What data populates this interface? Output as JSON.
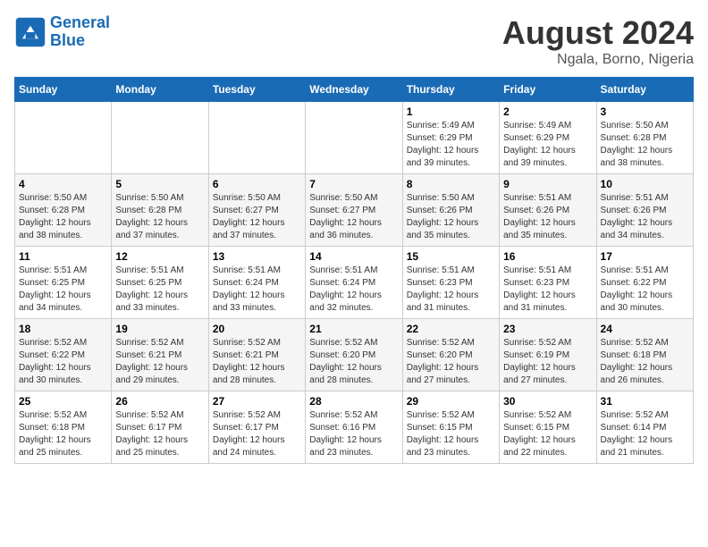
{
  "header": {
    "logo_general": "General",
    "logo_blue": "Blue",
    "month": "August 2024",
    "location": "Ngala, Borno, Nigeria"
  },
  "days_of_week": [
    "Sunday",
    "Monday",
    "Tuesday",
    "Wednesday",
    "Thursday",
    "Friday",
    "Saturday"
  ],
  "weeks": [
    [
      {
        "num": "",
        "info": ""
      },
      {
        "num": "",
        "info": ""
      },
      {
        "num": "",
        "info": ""
      },
      {
        "num": "",
        "info": ""
      },
      {
        "num": "1",
        "info": "Sunrise: 5:49 AM\nSunset: 6:29 PM\nDaylight: 12 hours\nand 39 minutes."
      },
      {
        "num": "2",
        "info": "Sunrise: 5:49 AM\nSunset: 6:29 PM\nDaylight: 12 hours\nand 39 minutes."
      },
      {
        "num": "3",
        "info": "Sunrise: 5:50 AM\nSunset: 6:28 PM\nDaylight: 12 hours\nand 38 minutes."
      }
    ],
    [
      {
        "num": "4",
        "info": "Sunrise: 5:50 AM\nSunset: 6:28 PM\nDaylight: 12 hours\nand 38 minutes."
      },
      {
        "num": "5",
        "info": "Sunrise: 5:50 AM\nSunset: 6:28 PM\nDaylight: 12 hours\nand 37 minutes."
      },
      {
        "num": "6",
        "info": "Sunrise: 5:50 AM\nSunset: 6:27 PM\nDaylight: 12 hours\nand 37 minutes."
      },
      {
        "num": "7",
        "info": "Sunrise: 5:50 AM\nSunset: 6:27 PM\nDaylight: 12 hours\nand 36 minutes."
      },
      {
        "num": "8",
        "info": "Sunrise: 5:50 AM\nSunset: 6:26 PM\nDaylight: 12 hours\nand 35 minutes."
      },
      {
        "num": "9",
        "info": "Sunrise: 5:51 AM\nSunset: 6:26 PM\nDaylight: 12 hours\nand 35 minutes."
      },
      {
        "num": "10",
        "info": "Sunrise: 5:51 AM\nSunset: 6:26 PM\nDaylight: 12 hours\nand 34 minutes."
      }
    ],
    [
      {
        "num": "11",
        "info": "Sunrise: 5:51 AM\nSunset: 6:25 PM\nDaylight: 12 hours\nand 34 minutes."
      },
      {
        "num": "12",
        "info": "Sunrise: 5:51 AM\nSunset: 6:25 PM\nDaylight: 12 hours\nand 33 minutes."
      },
      {
        "num": "13",
        "info": "Sunrise: 5:51 AM\nSunset: 6:24 PM\nDaylight: 12 hours\nand 33 minutes."
      },
      {
        "num": "14",
        "info": "Sunrise: 5:51 AM\nSunset: 6:24 PM\nDaylight: 12 hours\nand 32 minutes."
      },
      {
        "num": "15",
        "info": "Sunrise: 5:51 AM\nSunset: 6:23 PM\nDaylight: 12 hours\nand 31 minutes."
      },
      {
        "num": "16",
        "info": "Sunrise: 5:51 AM\nSunset: 6:23 PM\nDaylight: 12 hours\nand 31 minutes."
      },
      {
        "num": "17",
        "info": "Sunrise: 5:51 AM\nSunset: 6:22 PM\nDaylight: 12 hours\nand 30 minutes."
      }
    ],
    [
      {
        "num": "18",
        "info": "Sunrise: 5:52 AM\nSunset: 6:22 PM\nDaylight: 12 hours\nand 30 minutes."
      },
      {
        "num": "19",
        "info": "Sunrise: 5:52 AM\nSunset: 6:21 PM\nDaylight: 12 hours\nand 29 minutes."
      },
      {
        "num": "20",
        "info": "Sunrise: 5:52 AM\nSunset: 6:21 PM\nDaylight: 12 hours\nand 28 minutes."
      },
      {
        "num": "21",
        "info": "Sunrise: 5:52 AM\nSunset: 6:20 PM\nDaylight: 12 hours\nand 28 minutes."
      },
      {
        "num": "22",
        "info": "Sunrise: 5:52 AM\nSunset: 6:20 PM\nDaylight: 12 hours\nand 27 minutes."
      },
      {
        "num": "23",
        "info": "Sunrise: 5:52 AM\nSunset: 6:19 PM\nDaylight: 12 hours\nand 27 minutes."
      },
      {
        "num": "24",
        "info": "Sunrise: 5:52 AM\nSunset: 6:18 PM\nDaylight: 12 hours\nand 26 minutes."
      }
    ],
    [
      {
        "num": "25",
        "info": "Sunrise: 5:52 AM\nSunset: 6:18 PM\nDaylight: 12 hours\nand 25 minutes."
      },
      {
        "num": "26",
        "info": "Sunrise: 5:52 AM\nSunset: 6:17 PM\nDaylight: 12 hours\nand 25 minutes."
      },
      {
        "num": "27",
        "info": "Sunrise: 5:52 AM\nSunset: 6:17 PM\nDaylight: 12 hours\nand 24 minutes."
      },
      {
        "num": "28",
        "info": "Sunrise: 5:52 AM\nSunset: 6:16 PM\nDaylight: 12 hours\nand 23 minutes."
      },
      {
        "num": "29",
        "info": "Sunrise: 5:52 AM\nSunset: 6:15 PM\nDaylight: 12 hours\nand 23 minutes."
      },
      {
        "num": "30",
        "info": "Sunrise: 5:52 AM\nSunset: 6:15 PM\nDaylight: 12 hours\nand 22 minutes."
      },
      {
        "num": "31",
        "info": "Sunrise: 5:52 AM\nSunset: 6:14 PM\nDaylight: 12 hours\nand 21 minutes."
      }
    ]
  ]
}
